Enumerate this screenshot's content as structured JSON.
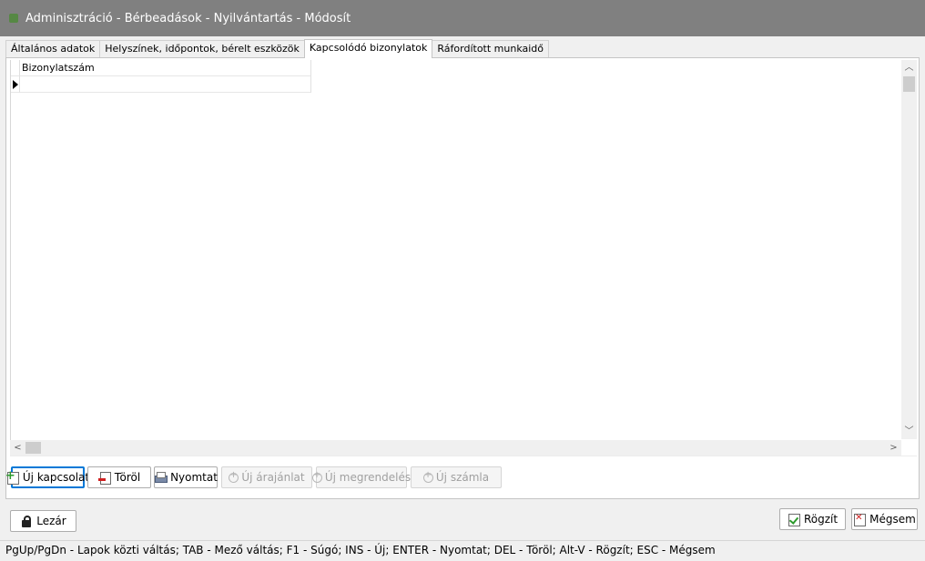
{
  "window": {
    "title": "Adminisztráció - Bérbeadások - Nyilvántartás - Módosít"
  },
  "tabs": [
    {
      "label": "Általános adatok"
    },
    {
      "label": "Helyszínek, időpontok, bérelt eszközök"
    },
    {
      "label": "Kapcsolódó bizonylatok"
    },
    {
      "label": "Ráfordított munkaidő"
    }
  ],
  "active_tab": "Kapcsolódó bizonylatok",
  "grid": {
    "columns": [
      "Bizonylatszám"
    ],
    "rows": [
      [
        ""
      ]
    ]
  },
  "actions": {
    "new_link": "Új kapcsolat",
    "delete": "Töröl",
    "print": "Nyomtat",
    "new_quote": "Új árajánlat",
    "new_order": "Új megrendelés",
    "new_invoice": "Új számla"
  },
  "footer": {
    "close": "Lezár",
    "save": "Rögzít",
    "cancel": "Mégsem"
  },
  "status": {
    "text": "PgUp/PgDn - Lapok közti váltás; TAB - Mező váltás; F1 - Súgó; INS - Új; ENTER - Nyomtat; DEL - Töröl; Alt-V - Rögzít; ESC - Mégsem"
  },
  "colors": {
    "titlebar": "#808080",
    "focus": "#0078d7",
    "panel": "#ffffff"
  }
}
